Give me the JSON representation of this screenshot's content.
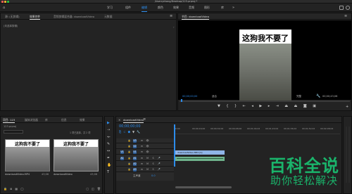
{
  "window": {
    "title": "/Users/zhang/Desktop/123.prproj *"
  },
  "menu": {
    "items": [
      "学习",
      "组件",
      "编辑",
      "颜色",
      "效果",
      "音频",
      "图形",
      "库"
    ],
    "active_index": 2
  },
  "source_panel": {
    "tabs": [
      "源: (无剪辑)",
      "效果控件",
      "音频剪辑混合器: downloadVideo",
      "元数据"
    ],
    "placeholder": "(未选择剪辑)"
  },
  "program_monitor": {
    "title": "节目: downloadVideo",
    "caption": "这狗我不要了",
    "timecode": "00;00;00;00",
    "fit": "适合",
    "quality": "完整",
    "duration": "00;00;43;06"
  },
  "project_panel": {
    "tabs": [
      "项目: 123",
      "媒体浏览器",
      "库",
      "信息",
      "效果"
    ],
    "project_file": "123.prproj",
    "selection_info": "1 项已选择，共 2 项",
    "items": [
      {
        "name": "downloadVideo.MP4",
        "duration": "43;06",
        "thumb_text": "这狗我不要了"
      },
      {
        "name": "downloadVideo",
        "duration": "43;06",
        "thumb_text": "这狗我不要了"
      }
    ]
  },
  "timeline": {
    "tab": "downloadVideo",
    "timecode": "00;00;00;00",
    "ruler": [
      "00;00",
      "00;00;16;00",
      "00;00;32;00",
      "00;00;48;00",
      "00;01;04;02",
      "00;01;20;02",
      "00;01;36;02",
      "00;01;52;02",
      "00;02;08;04"
    ],
    "video_tracks": [
      "V3",
      "V2",
      "V1"
    ],
    "audio_tracks": [
      "A1",
      "A2",
      "A3"
    ],
    "master_label": "主声道",
    "master_value": "0.0",
    "video_clip": "downloadVideo.MP4 [V]"
  },
  "watermark": {
    "title": "百科全说",
    "subtitle": "助你轻松解决"
  }
}
